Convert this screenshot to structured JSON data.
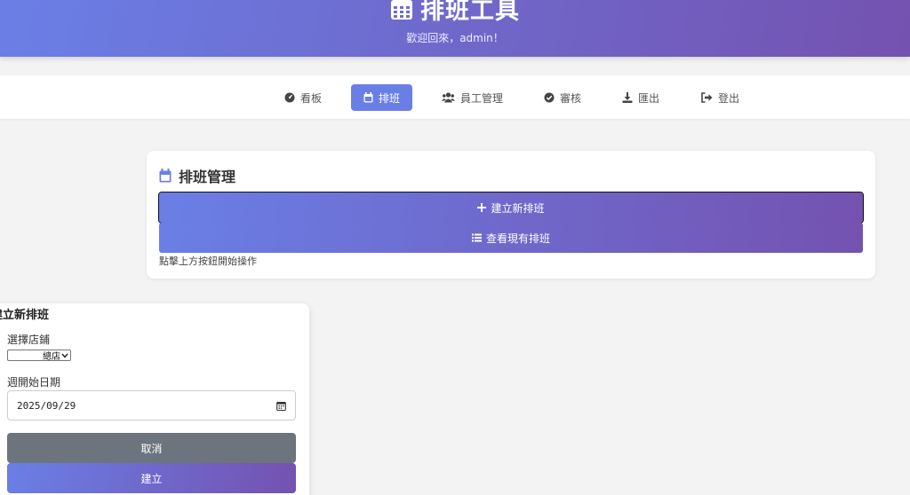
{
  "header": {
    "title": "排班工具",
    "welcome": "歡迎回來，admin！",
    "colors": {
      "gradient_start": "#6a7fe6",
      "gradient_end": "#7452b0"
    }
  },
  "nav": {
    "items": [
      {
        "label": "看板",
        "icon": "dashboard-icon",
        "active": false
      },
      {
        "label": "排班",
        "icon": "calendar-icon",
        "active": true
      },
      {
        "label": "員工管理",
        "icon": "users-icon",
        "active": false
      },
      {
        "label": "審核",
        "icon": "check-circle-icon",
        "active": false
      },
      {
        "label": "匯出",
        "icon": "download-icon",
        "active": false
      },
      {
        "label": "登出",
        "icon": "logout-icon",
        "active": false
      }
    ]
  },
  "schedule_card": {
    "title": "排班管理",
    "create_button": "建立新排班",
    "view_button": "查看現有排班",
    "hint": "點擊上方按鈕開始操作"
  },
  "create_modal": {
    "title": "建立新排班",
    "store_label": "選擇店鋪",
    "store_value": "總店",
    "start_date_label": "週開始日期",
    "start_date_value": "2025/09/29",
    "cancel_button": "取消",
    "create_button": "建立"
  }
}
